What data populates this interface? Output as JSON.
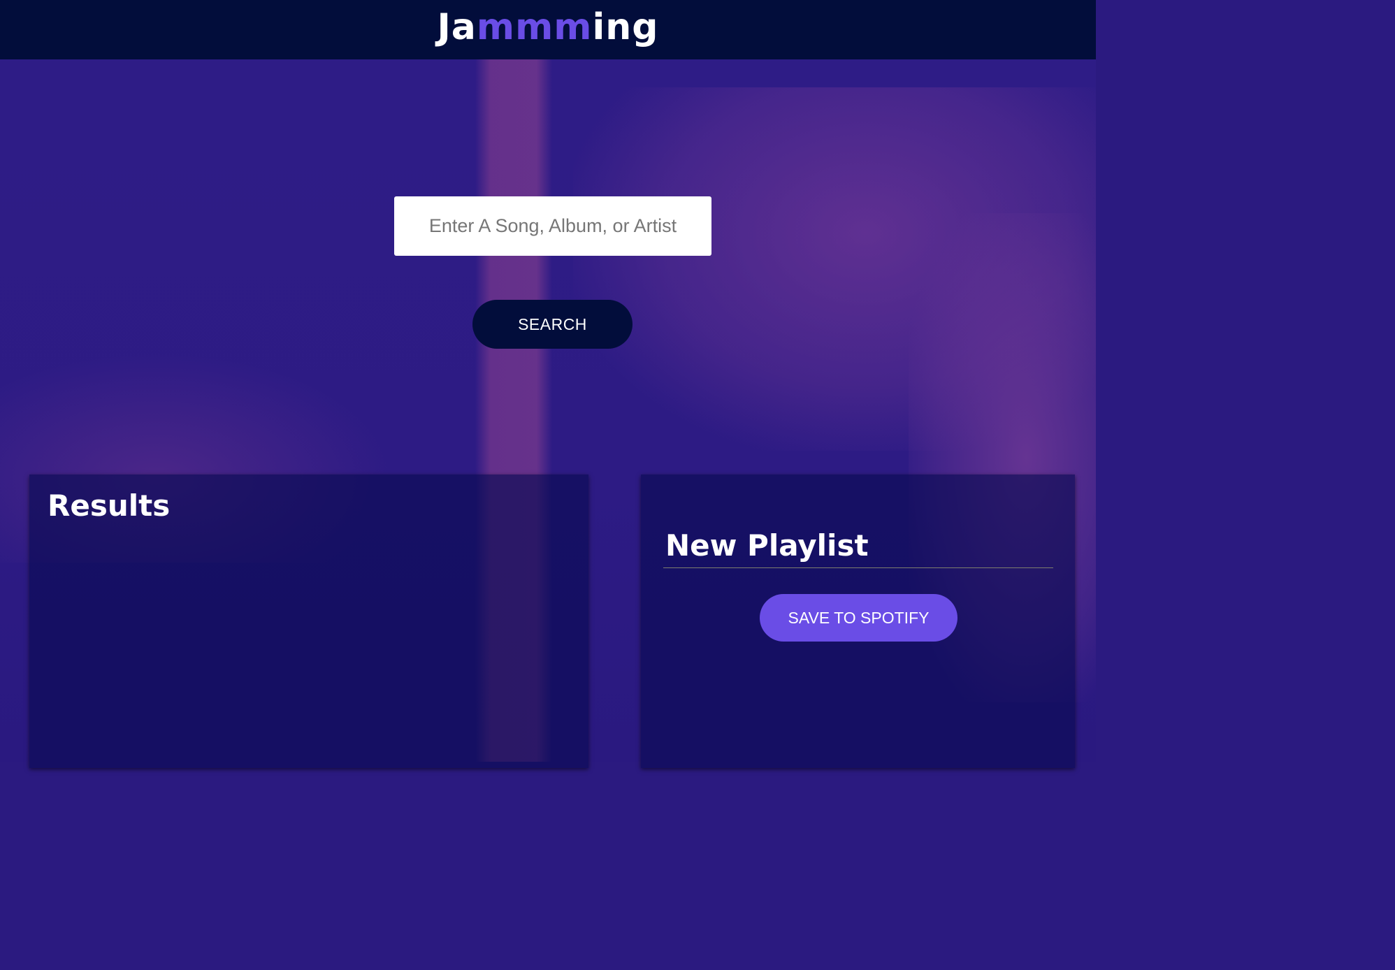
{
  "header": {
    "logo_prefix": "Ja",
    "logo_accent": "mmm",
    "logo_suffix": "ing",
    "accent_color": "#6a4de6",
    "background_color": "#020d3b"
  },
  "search": {
    "placeholder": "Enter A Song, Album, or Artist",
    "value": "",
    "button_label": "SEARCH"
  },
  "results": {
    "title": "Results",
    "tracks": []
  },
  "playlist": {
    "name": "New Playlist",
    "tracks": [],
    "save_label": "SAVE TO SPOTIFY",
    "save_color": "#6a4de6"
  }
}
